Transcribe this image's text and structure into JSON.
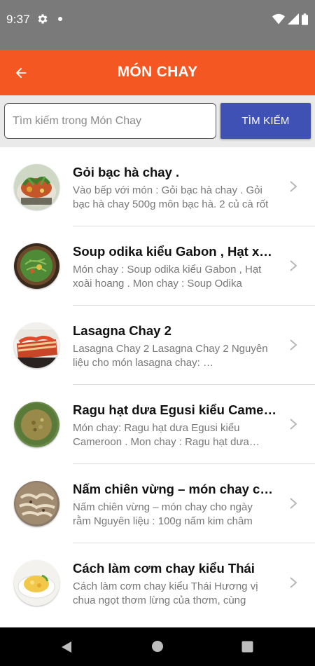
{
  "status_bar": {
    "time": "9:37",
    "icons": [
      "settings-gear-icon",
      "notification-dot-icon",
      "wifi-icon",
      "signal-icon",
      "battery-icon"
    ]
  },
  "app_bar": {
    "title": "MÓN CHAY",
    "back_icon": "arrow-back-icon",
    "color": "#f55722"
  },
  "search": {
    "placeholder": "Tìm kiếm trong Món Chay",
    "value": "",
    "button_label": "TÌM KIẾM",
    "button_color": "#3f51b5"
  },
  "recipes": [
    {
      "title": "Gỏi bạc hà chay .",
      "description": "Vào bếp với món : Gỏi bạc hà chay . Gỏi bạc hà chay 500g môn bạc hà. 2 củ cà rốt",
      "thumbnail": "salad-bowl-image"
    },
    {
      "title": "Soup odika kiểu Gabon , Hạt xoài hoang",
      "description": "Món chay : Soup odika kiểu Gabon , Hạt xoài hoang .    Mon chay : Soup Odika",
      "thumbnail": "green-soup-image"
    },
    {
      "title": "Lasagna Chay 2",
      "description": "Lasagna Chay 2  Lasagna Chay 2 Nguyên liệu cho món lasagna chay:   …",
      "thumbnail": "lasagna-image"
    },
    {
      "title": "Ragu hạt dưa Egusi kiểu Cameroon",
      "description": "Món chay: Ragu hạt dưa Egusi kiểu Cameroon .    Mon chay : Ragu hạt dưa Egusi",
      "thumbnail": "ragu-image"
    },
    {
      "title": "Nấm chiên vừng – món chay cho ngày rằm",
      "description": "Nấm chiên vừng – món chay cho ngày rằm    Nguyên liệu :  100g nấm kim châm",
      "thumbnail": "fried-mushroom-image"
    },
    {
      "title": "Cách làm cơm chay kiểu Thái",
      "description": "Cách làm cơm chay kiểu Thái  Hương vị chua ngọt thơm lừng của thơm, cùng",
      "thumbnail": "thai-rice-image"
    }
  ],
  "nav_bar": {
    "icons": [
      "nav-back-icon",
      "nav-home-icon",
      "nav-recents-icon"
    ]
  }
}
